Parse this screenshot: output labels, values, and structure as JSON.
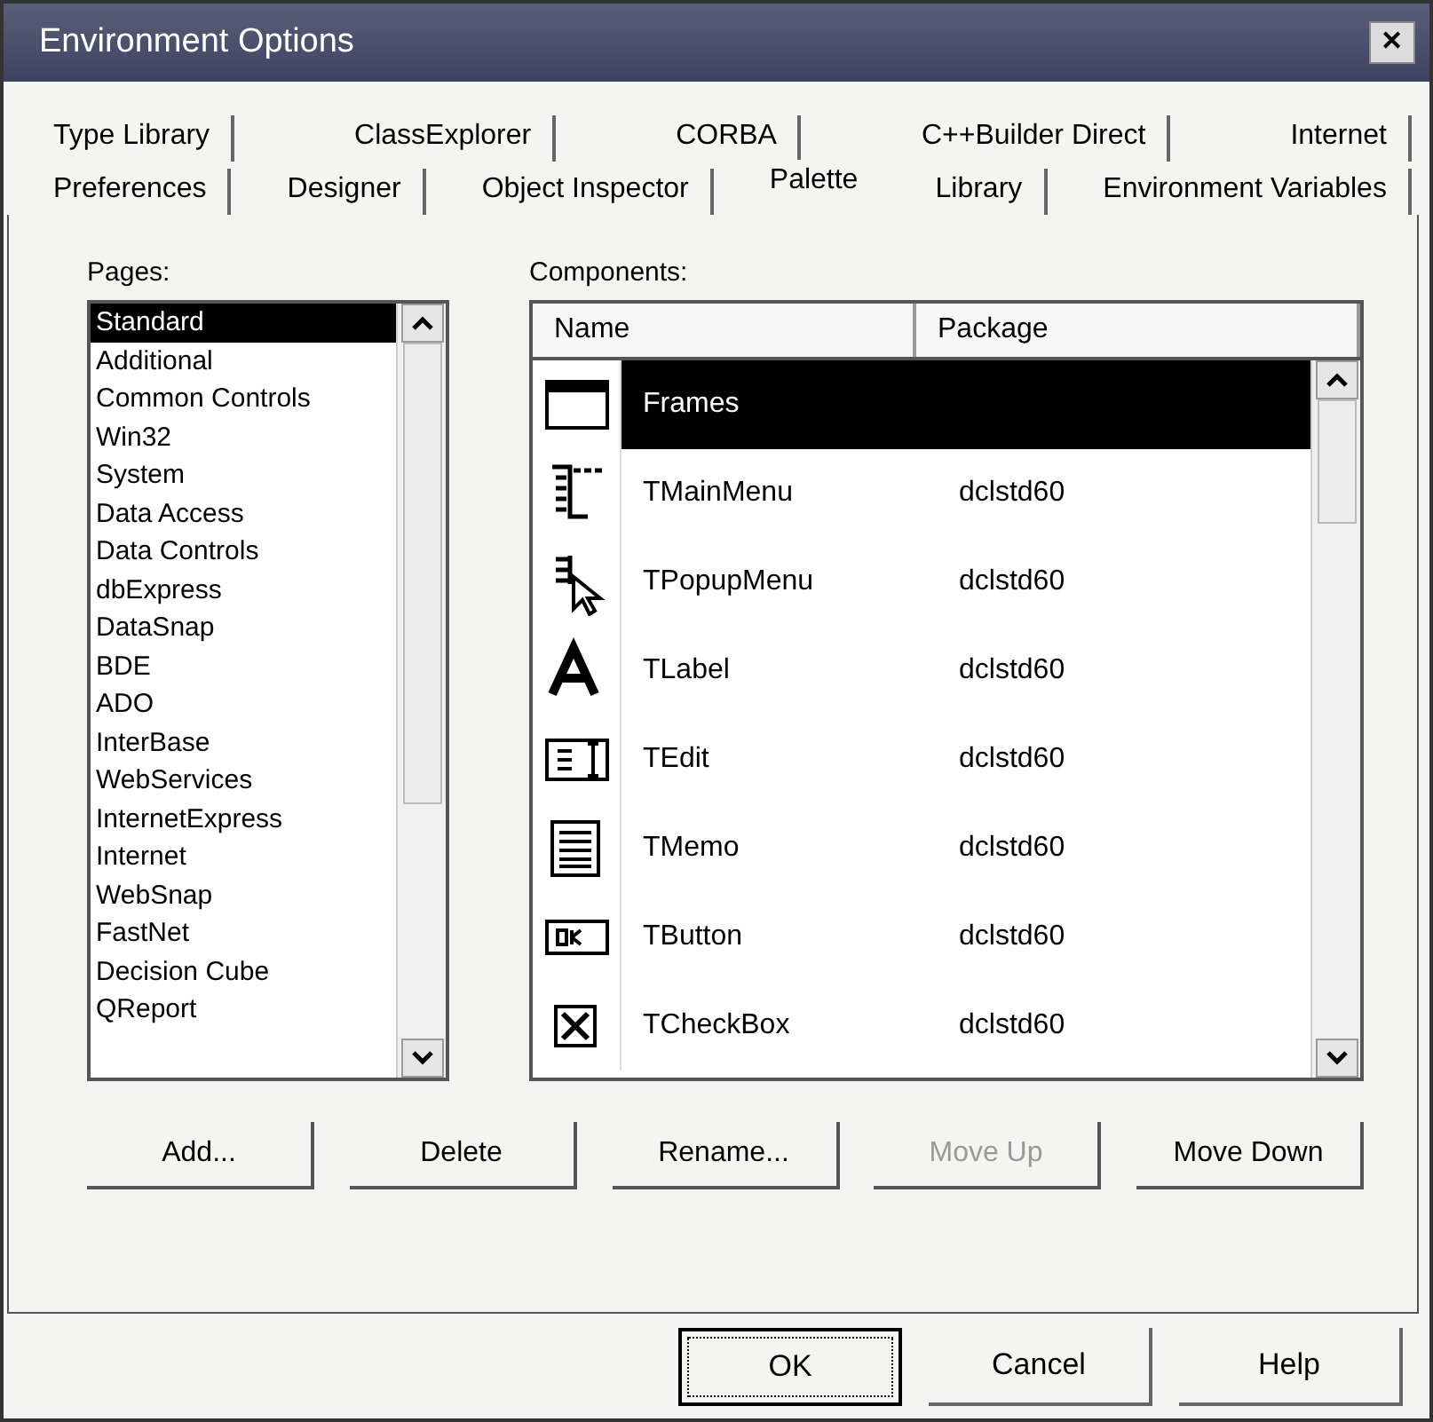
{
  "window": {
    "title": "Environment Options",
    "close": "✕"
  },
  "tab_rows": [
    [
      {
        "label": "Type Library",
        "selected": false
      },
      {
        "label": "ClassExplorer",
        "selected": false
      },
      {
        "label": "CORBA",
        "selected": false
      },
      {
        "label": "C++Builder Direct",
        "selected": false
      },
      {
        "label": "Internet",
        "selected": false
      }
    ],
    [
      {
        "label": "Preferences",
        "selected": false
      },
      {
        "label": "Designer",
        "selected": false
      },
      {
        "label": "Object Inspector",
        "selected": false
      },
      {
        "label": "Palette",
        "selected": true
      },
      {
        "label": "Library",
        "selected": false
      },
      {
        "label": "Environment Variables",
        "selected": false
      }
    ]
  ],
  "pages": {
    "label": "Pages:",
    "items": [
      {
        "label": "Standard",
        "selected": true
      },
      {
        "label": "Additional",
        "selected": false
      },
      {
        "label": "Common Controls",
        "selected": false
      },
      {
        "label": "Win32",
        "selected": false
      },
      {
        "label": "System",
        "selected": false
      },
      {
        "label": "Data Access",
        "selected": false
      },
      {
        "label": "Data Controls",
        "selected": false
      },
      {
        "label": "dbExpress",
        "selected": false
      },
      {
        "label": "DataSnap",
        "selected": false
      },
      {
        "label": "BDE",
        "selected": false
      },
      {
        "label": "ADO",
        "selected": false
      },
      {
        "label": "InterBase",
        "selected": false
      },
      {
        "label": "WebServices",
        "selected": false
      },
      {
        "label": "InternetExpress",
        "selected": false
      },
      {
        "label": "Internet",
        "selected": false
      },
      {
        "label": "WebSnap",
        "selected": false
      },
      {
        "label": "FastNet",
        "selected": false
      },
      {
        "label": "Decision Cube",
        "selected": false
      },
      {
        "label": "QReport",
        "selected": false
      }
    ]
  },
  "components": {
    "label": "Components:",
    "columns": [
      "Name",
      "Package"
    ],
    "rows": [
      {
        "kind": "frame",
        "name": "Frames",
        "selected": true
      },
      {
        "kind": "menu",
        "name": "TMainMenu",
        "package": "dclstd60",
        "selected": false
      },
      {
        "kind": "popup",
        "name": "TPopupMenu",
        "package": "dclstd60",
        "selected": false
      },
      {
        "kind": "label",
        "name": "TLabel",
        "package": "dclstd60",
        "selected": false
      },
      {
        "kind": "edit",
        "name": "TEdit",
        "package": "dclstd60",
        "selected": false
      },
      {
        "kind": "memo",
        "name": "TMemo",
        "package": "dclstd60",
        "selected": false
      },
      {
        "kind": "button",
        "name": "TButton",
        "package": "dclstd60",
        "selected": false
      },
      {
        "kind": "checkbox",
        "name": "TCheckBox",
        "package": "dclstd60",
        "selected": false
      }
    ]
  },
  "page_buttons": [
    {
      "label": "Add...",
      "disabled": false
    },
    {
      "label": "Delete",
      "disabled": false
    },
    {
      "label": "Rename...",
      "disabled": false
    },
    {
      "label": "Move Up",
      "disabled": true
    },
    {
      "label": "Move Down",
      "disabled": false
    }
  ],
  "dialog_buttons": [
    {
      "label": "OK",
      "default": true
    },
    {
      "label": "Cancel",
      "default": false
    },
    {
      "label": "Help",
      "default": false
    }
  ]
}
